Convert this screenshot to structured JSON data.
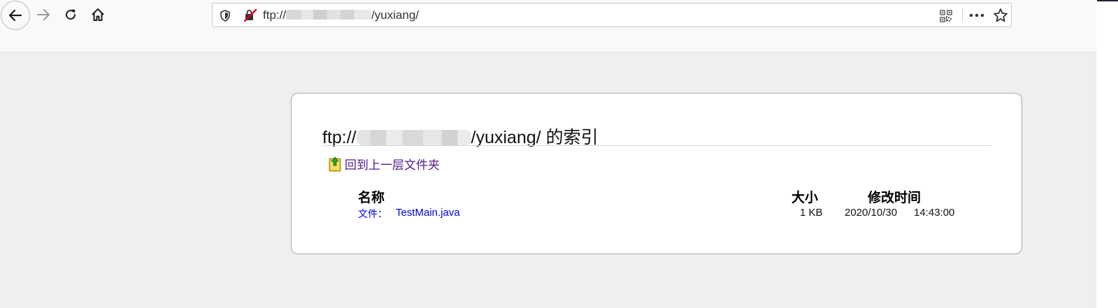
{
  "browser": {
    "url": {
      "scheme": "ftp://",
      "path": "/yuxiang/"
    },
    "icons": {
      "back": "arrow-left-icon",
      "forward": "arrow-right-icon",
      "reload": "reload-icon",
      "home": "home-icon",
      "tracking": "shield-icon",
      "insecure": "insecure-connection-icon",
      "qr": "qr-code-icon",
      "more": "more-horizontal-icon",
      "bookmark": "star-icon"
    }
  },
  "page": {
    "title": {
      "prefix": "ftp://",
      "suffix": "/yuxiang/ 的索引"
    },
    "up_link": "回到上一层文件夹",
    "columns": {
      "name": "名称",
      "size": "大小",
      "modified": "修改时间"
    },
    "rows": [
      {
        "type": "文件：",
        "name": "TestMain.java",
        "size": "1 KB",
        "date": "2020/10/30",
        "time": "14:43:00"
      }
    ]
  },
  "colors": {
    "link": "#0000ee",
    "visited_link": "#551a8b",
    "page_background": "#efefef",
    "insecure_red": "#d70022"
  }
}
